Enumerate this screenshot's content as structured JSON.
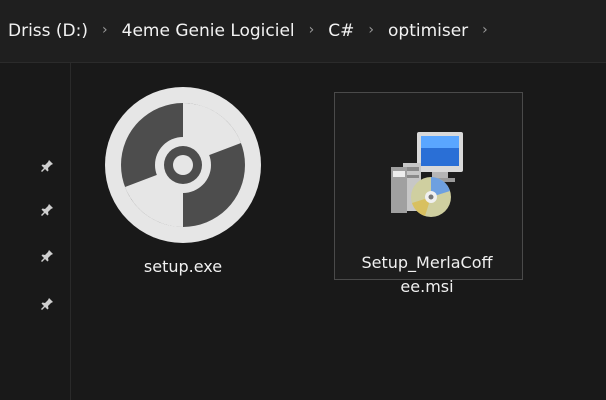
{
  "breadcrumb": {
    "items": [
      "Driss (D:)",
      "4eme Genie Logiciel",
      "C#",
      "optimiser"
    ],
    "separator": "›"
  },
  "files": [
    {
      "label_line1": "setup.exe",
      "label_line2": "",
      "icon": "disc-icon"
    },
    {
      "label_line1": "Setup_MerlaCoff",
      "label_line2": "ee.msi",
      "icon": "installer-icon"
    }
  ],
  "colors": {
    "background": "#191919",
    "addressbar": "#1f1f1f",
    "text": "#f2f2f2",
    "separator": "#9a9a9a",
    "icon_gray": "#e6e6e6",
    "disc_dark": "#555555"
  }
}
